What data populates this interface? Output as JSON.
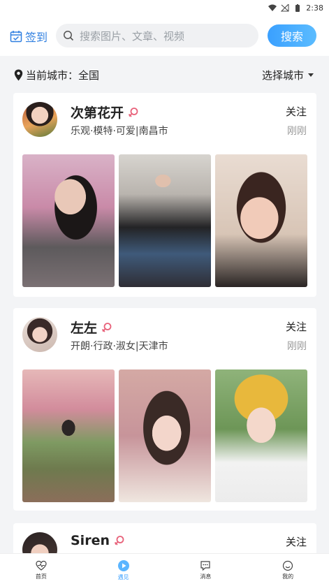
{
  "status": {
    "time": "2:38"
  },
  "header": {
    "checkin_label": "签到",
    "search_placeholder": "搜索图片、文章、视频",
    "search_button": "搜索"
  },
  "city": {
    "current": "当前城市：全国",
    "select": "选择城市"
  },
  "posts": [
    {
      "name": "次第花开",
      "tags": "乐观·模特·可爱|南昌市",
      "follow": "关注",
      "time": "刚刚"
    },
    {
      "name": "左左",
      "tags": "开朗·行政·淑女|天津市",
      "follow": "关注",
      "time": "刚刚"
    },
    {
      "name": "Siren",
      "follow": "关注"
    }
  ],
  "tabs": [
    {
      "label": "首页"
    },
    {
      "label": "遇见"
    },
    {
      "label": "消息"
    },
    {
      "label": "我的"
    }
  ],
  "colors": {
    "accent": "#3aa0ff",
    "female_icon": "#e8627a",
    "checkin": "#2f7fe0"
  }
}
